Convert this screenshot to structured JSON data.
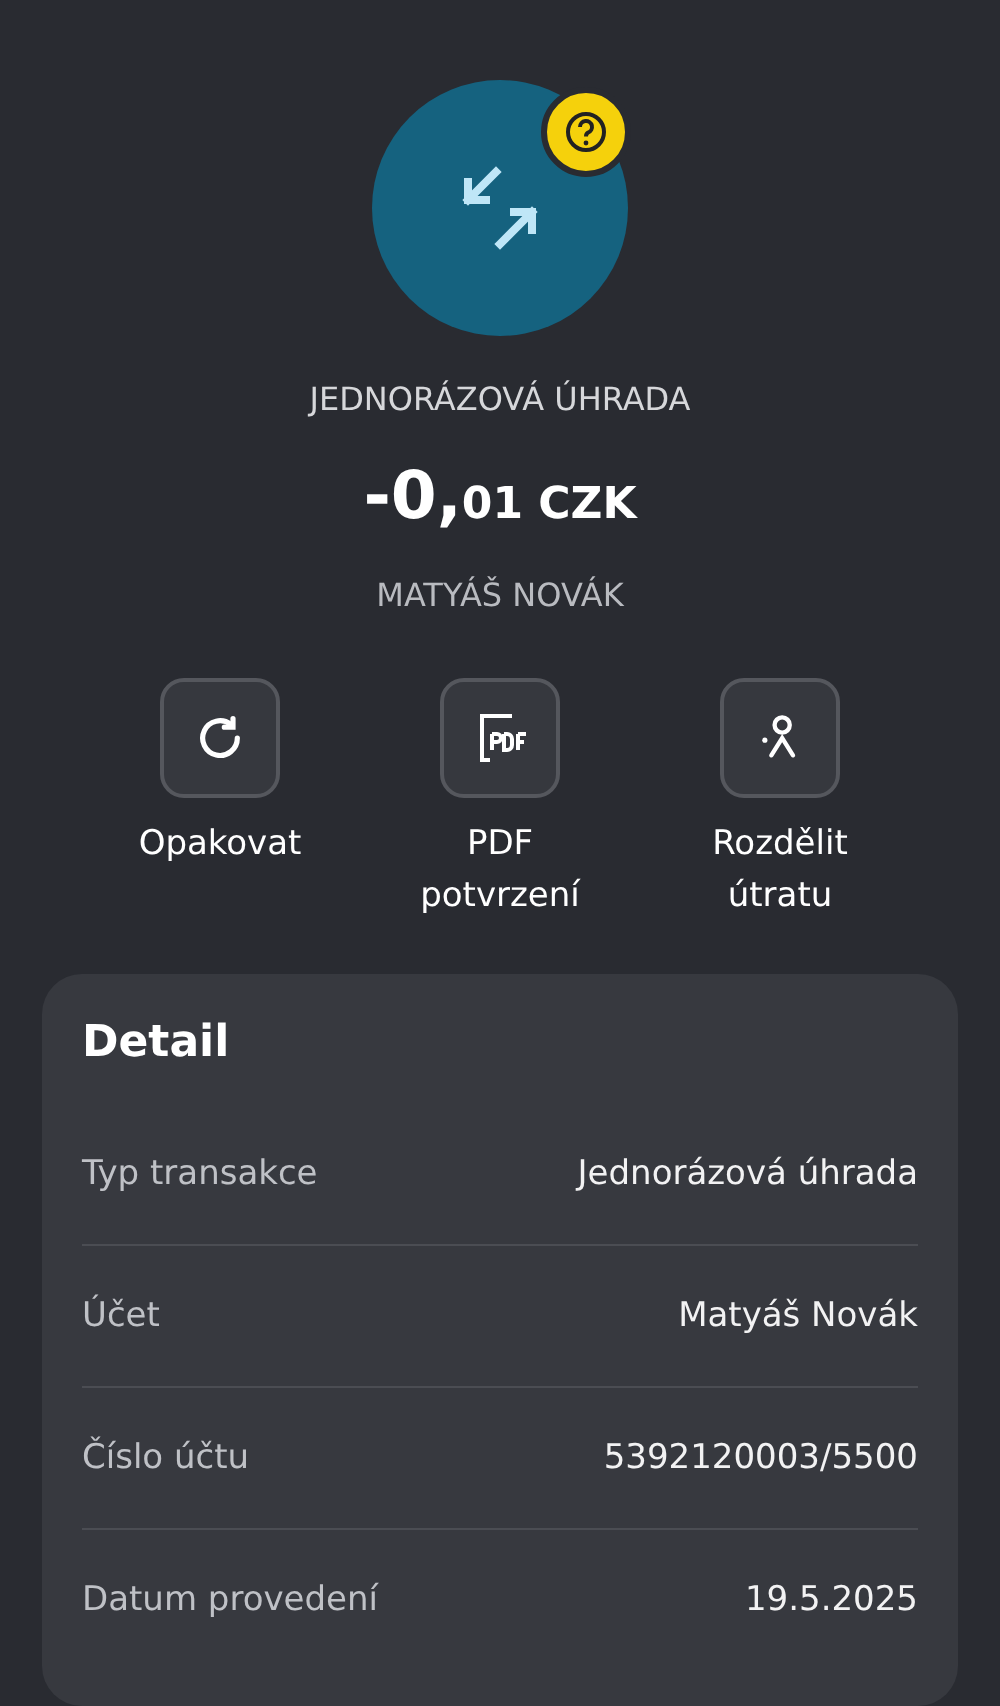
{
  "header": {
    "title": "JEDNORÁZOVÁ ÚHRADA",
    "amount_main": "-0,",
    "amount_minor": "01 CZK",
    "counterparty": "MATYÁŠ NOVÁK"
  },
  "actions": [
    {
      "kind": "repeat",
      "label": "Opakovat"
    },
    {
      "kind": "pdf",
      "label": "PDF potvrzení"
    },
    {
      "kind": "split",
      "label": "Rozdělit útratu"
    }
  ],
  "detail": {
    "title": "Detail",
    "rows": [
      {
        "label": "Typ transakce",
        "value": "Jednorázová úhrada"
      },
      {
        "label": "Účet",
        "value": "Matyáš Novák"
      },
      {
        "label": "Číslo účtu",
        "value": "5392120003/5500"
      },
      {
        "label": "Datum provedení",
        "value": "19.5.2025"
      }
    ]
  }
}
